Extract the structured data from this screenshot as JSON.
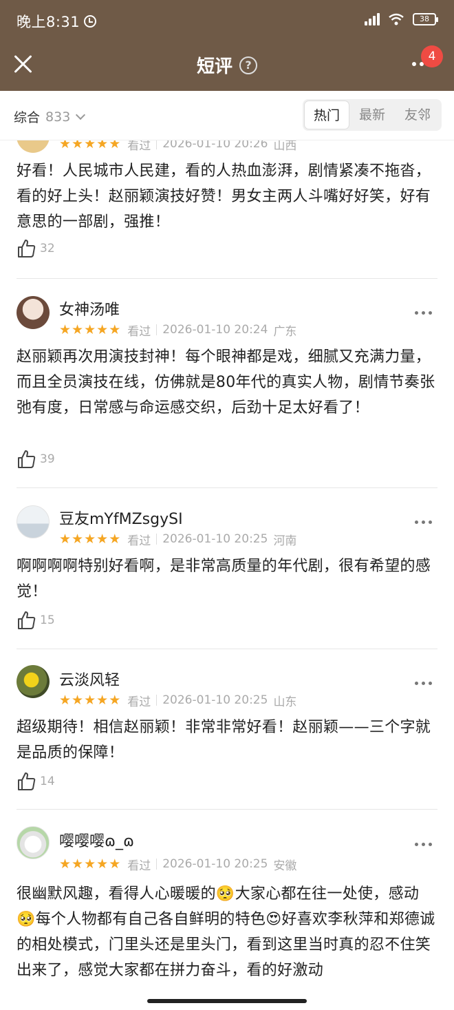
{
  "status": {
    "time": "晚上8:31",
    "battery": "38"
  },
  "header": {
    "title": "短评",
    "help": "?",
    "badge": "4"
  },
  "filter": {
    "sort_label": "综合",
    "count": "833",
    "tabs": [
      "热门",
      "最新",
      "友邻"
    ],
    "active_tab": "热门"
  },
  "rating_star": "★",
  "reviews": [
    {
      "status": "看过",
      "date": "2026-01-10 20:26",
      "region": "山西",
      "content": "好看！人民城市人民建，看的人热血澎湃，剧情紧凑不拖沓，看的好上头！赵丽颖演技好赞！男女主两人斗嘴好好笑，好有意思的一部剧，强推！",
      "likes": "32"
    },
    {
      "name": "女神汤唯",
      "status": "看过",
      "date": "2026-01-10 20:24",
      "region": "广东",
      "content": "赵丽颖再次用演技封神！每个眼神都是戏，细腻又充满力量，而且全员演技在线，仿佛就是80年代的真实人物，剧情节奏张弛有度，日常感与命运感交织，后劲十足太好看了！",
      "likes": "39"
    },
    {
      "name": "豆友mYfMZsgySI",
      "status": "看过",
      "date": "2026-01-10 20:25",
      "region": "河南",
      "content": "啊啊啊啊特别好看啊，是非常高质量的年代剧，很有希望的感觉！",
      "likes": "15"
    },
    {
      "name": "云淡风轻",
      "status": "看过",
      "date": "2026-01-10 20:25",
      "region": "山东",
      "content": "超级期待！相信赵丽颖！非常非常好看！赵丽颖——三个字就是品质的保障！",
      "likes": "14"
    },
    {
      "name": "嘤嘤嘤ɷ_ɷ",
      "status": "看过",
      "date": "2026-01-10 20:25",
      "region": "安徽",
      "content": "很幽默风趣，看得人心暖暖的🥺大家心都在往一处使，感动🥺每个人物都有自己各自鲜明的特色😍好喜欢李秋萍和郑德诚的相处模式，门里头还是里头门，看到这里当时真的忍不住笑出来了，感觉大家都在拼力奋斗，看的好激动"
    }
  ]
}
